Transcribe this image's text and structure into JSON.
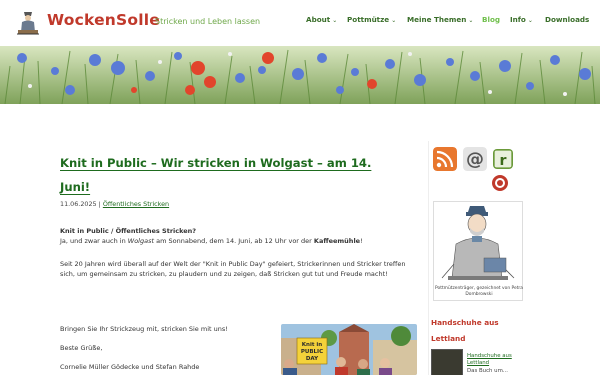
{
  "header": {
    "site_title": "WockenSolle",
    "tagline": "Stricken und Leben lassen",
    "logo_icon": "knitter-logo-icon"
  },
  "nav": {
    "items": [
      {
        "label": "About",
        "dropdown": true,
        "active": false
      },
      {
        "label": "Pottmütze",
        "dropdown": true,
        "active": false
      },
      {
        "label": "Meine Themen",
        "dropdown": true,
        "active": false
      },
      {
        "label": "Blog",
        "dropdown": false,
        "active": true
      },
      {
        "label": "Info",
        "dropdown": true,
        "active": false
      },
      {
        "label": "Downloads",
        "dropdown": false,
        "active": false
      }
    ],
    "chevron": "⌄"
  },
  "banner": {
    "icon": "flower-meadow-banner"
  },
  "post": {
    "title": "Knit in Public – Wir stricken in Wolgast – am 14. Juni!",
    "date": "11.06.2025",
    "separator": "|",
    "category": "Öffentliches Stricken",
    "p1_question": "Knit in Public / Öffentliches Stricken?",
    "p1_a": "Ja, und zwar auch in ",
    "p1_place": "Wolgast",
    "p1_b": " am Sonnabend, dem 14. Juni, ab 12 Uhr vor der ",
    "p1_venue": "Kaffeemühle",
    "p1_end": "!",
    "p2": "Seit 20 Jahren wird überall auf der Welt der \"Knit in Public Day\" gefeiert, Strickerinnen und Stricker treffen sich, um gemeinsam zu stricken, zu plaudern und zu zeigen, daß Stricken gut tut und Freude macht!",
    "p3": "Bringen Sie Ihr Strickzeug mit, stricken Sie mit uns!",
    "p4": "Beste Grüße,",
    "p5": "Cornelie Müller Gödecke und Stefan Rahde",
    "photo_sign": "Knit in PUBLIC DAY"
  },
  "sidebar": {
    "icons": [
      {
        "name": "rss-feed-icon",
        "color": "#e8772e"
      },
      {
        "name": "email-at-icon",
        "color": "#9a9a9a"
      },
      {
        "name": "ravelry-icon",
        "color": "#6b9a3a"
      }
    ],
    "portrait_caption": "Pottmützenträger, gezeichnet von Petra Dombrowski",
    "widget_title": "Handschuhe aus Lettland",
    "book_link": "Handschuhe aus Lettland",
    "book_sub": "Das Buch um..."
  },
  "colors": {
    "brand_red": "#c0392b",
    "nav_green": "#3a6e2a",
    "link_green": "#1e6b1e",
    "tagline_green": "#6fa84a"
  }
}
